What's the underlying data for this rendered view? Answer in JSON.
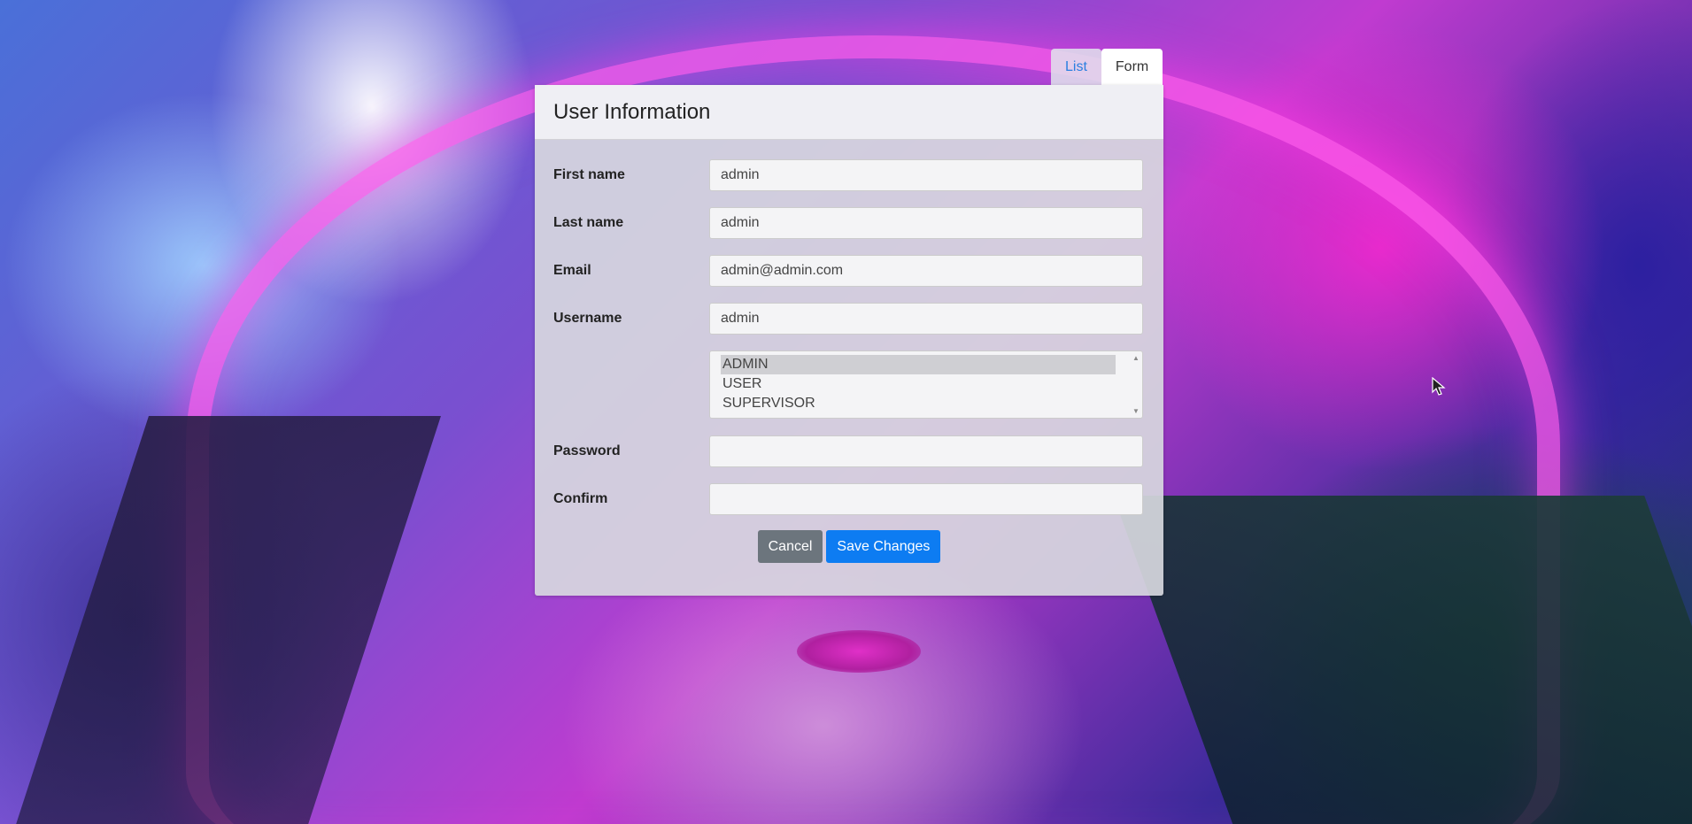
{
  "tabs": {
    "list_label": "List",
    "form_label": "Form"
  },
  "panel": {
    "title": "User Information"
  },
  "fields": {
    "first_name": {
      "label": "First name",
      "value": "admin"
    },
    "last_name": {
      "label": "Last name",
      "value": "admin"
    },
    "email": {
      "label": "Email",
      "value": "admin@admin.com"
    },
    "username": {
      "label": "Username",
      "value": "admin"
    },
    "password": {
      "label": "Password",
      "value": ""
    },
    "confirm": {
      "label": "Confirm",
      "value": ""
    }
  },
  "roles": {
    "options": [
      "ADMIN",
      "USER",
      "SUPERVISOR"
    ],
    "selected": "ADMIN"
  },
  "buttons": {
    "cancel_label": "Cancel",
    "save_label": "Save Changes"
  },
  "colors": {
    "primary": "#0d7cf2",
    "secondary": "#6c757d",
    "tab_active_text": "#2a7fe0"
  }
}
